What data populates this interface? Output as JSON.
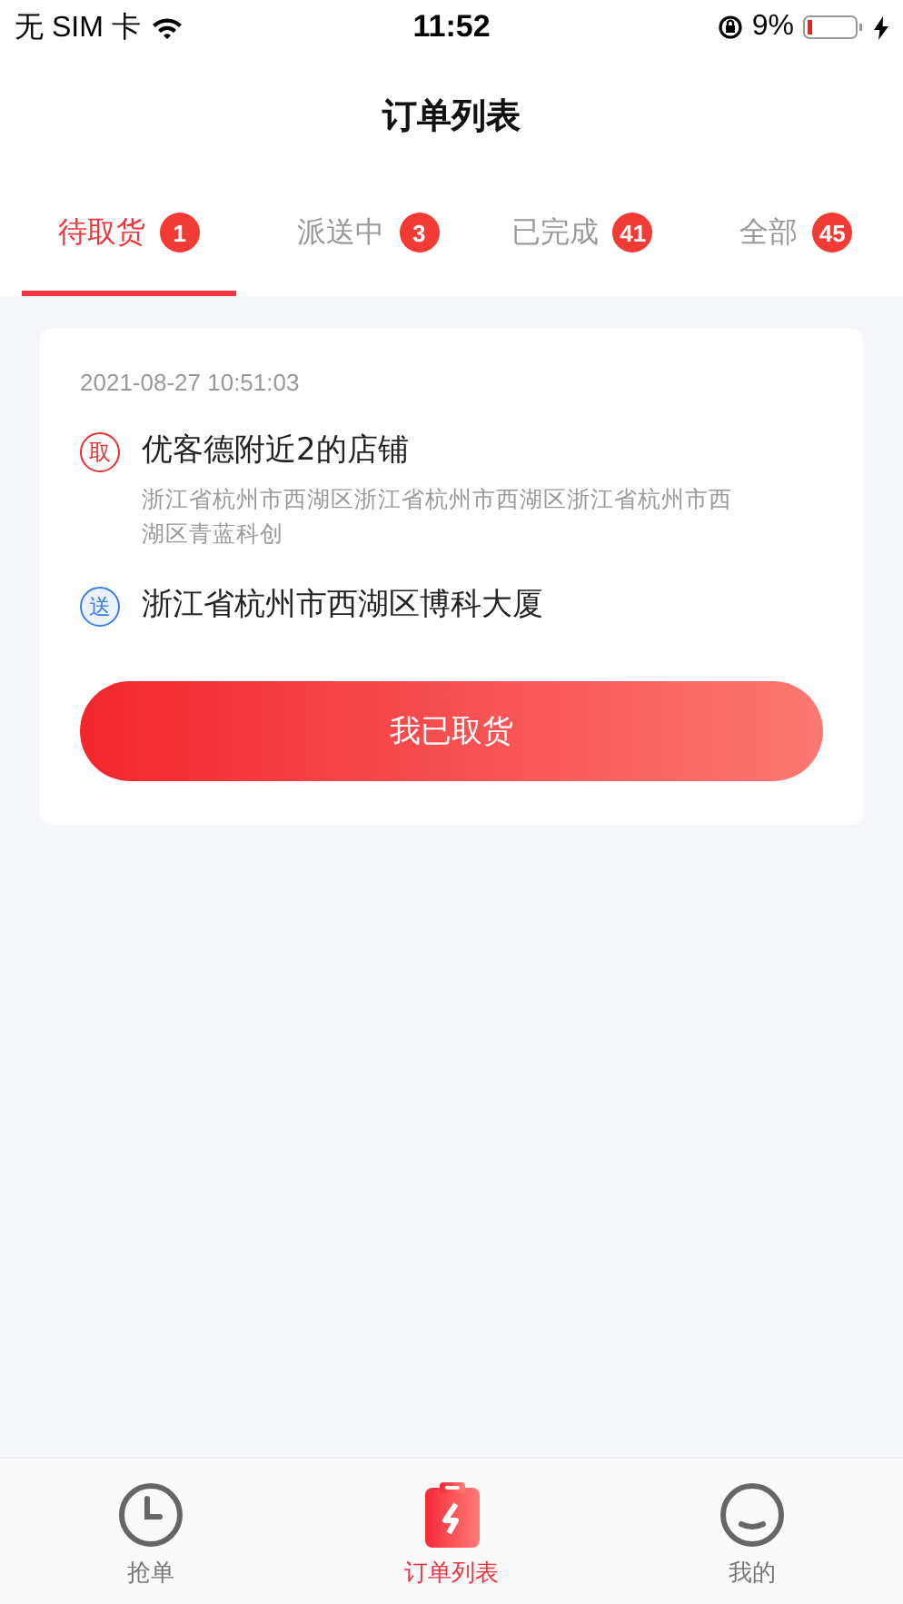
{
  "status_bar": {
    "carrier": "无 SIM 卡",
    "time": "11:52",
    "battery": "9%"
  },
  "nav": {
    "title": "订单列表"
  },
  "tabs": [
    {
      "label": "待取货",
      "count": "1",
      "selected": true
    },
    {
      "label": "派送中",
      "count": "3",
      "selected": false
    },
    {
      "label": "已完成",
      "count": "41",
      "selected": false
    },
    {
      "label": "全部",
      "count": "45",
      "selected": false
    }
  ],
  "orders": [
    {
      "time": "2021-08-27 10:51:03",
      "stops": [
        {
          "kind": "pickup",
          "badge": "取",
          "name": "优客德附近2的店铺",
          "address": "浙江省杭州市西湖区浙江省杭州市西湖区浙江省杭州市西湖区青蓝科创"
        },
        {
          "kind": "delivery",
          "badge": "送",
          "name": "浙江省杭州市西湖区博科大厦"
        }
      ],
      "action": "我已取货"
    }
  ],
  "tab_bar": [
    {
      "kind": "clock",
      "label": "抢单",
      "selected": false
    },
    {
      "kind": "clipboard",
      "label": "订单列表",
      "selected": true
    },
    {
      "kind": "smile",
      "label": "我的",
      "selected": false
    }
  ]
}
